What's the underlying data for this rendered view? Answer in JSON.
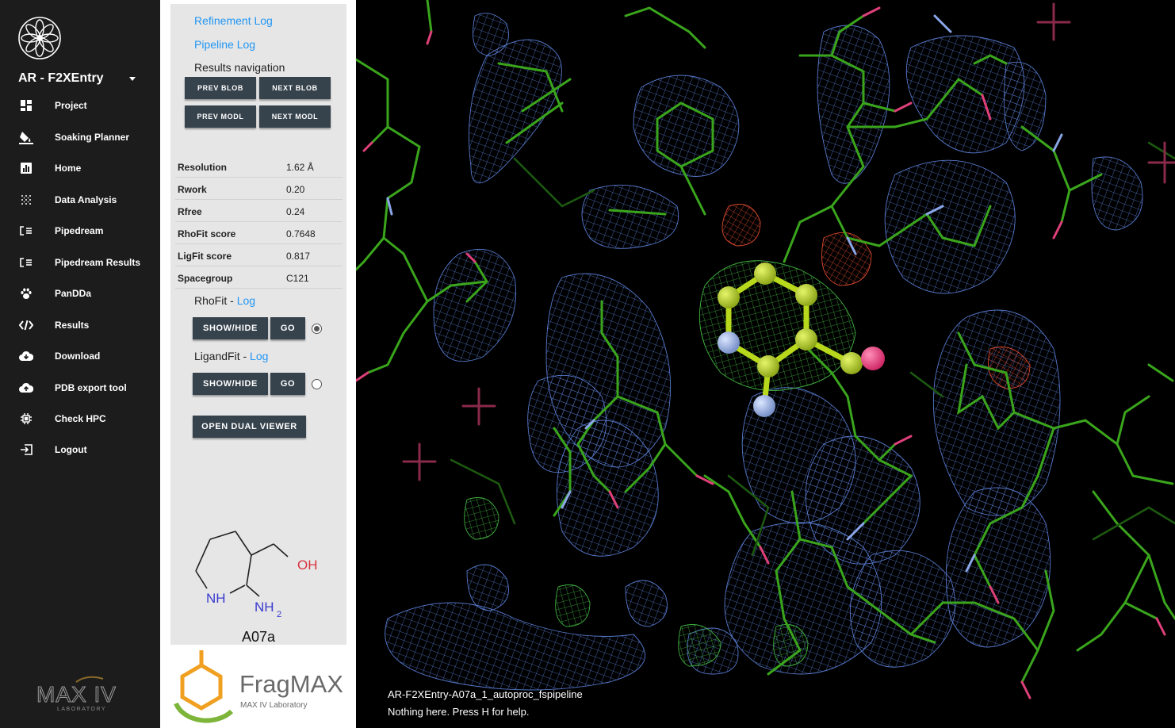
{
  "nav": {
    "project": "AR - F2XEntry",
    "items": [
      {
        "label": "Project",
        "icon": "dashboard-icon"
      },
      {
        "label": "Soaking Planner",
        "icon": "paint-bucket-icon"
      },
      {
        "label": "Home",
        "icon": "bar-chart-icon"
      },
      {
        "label": "Data Analysis",
        "icon": "grid-dots-icon"
      },
      {
        "label": "Pipedream",
        "icon": "list-check-icon"
      },
      {
        "label": "Pipedream Results",
        "icon": "list-check-icon"
      },
      {
        "label": "PanDDa",
        "icon": "paw-icon"
      },
      {
        "label": "Results",
        "icon": "code-slash-icon"
      },
      {
        "label": "Download",
        "icon": "cloud-download-icon"
      },
      {
        "label": "PDB export tool",
        "icon": "cloud-upload-icon"
      },
      {
        "label": "Check HPC",
        "icon": "chip-icon"
      },
      {
        "label": "Logout",
        "icon": "logout-icon"
      }
    ],
    "footer_logo_text": "MAX IV",
    "footer_logo_sub": "LABORATORY"
  },
  "panel": {
    "refinement_log": "Refinement Log",
    "pipeline_log": "Pipeline Log",
    "results_navigation": "Results navigation",
    "buttons": {
      "prev_blob": "PREV BLOB",
      "next_blob": "NEXT BLOB",
      "prev_modl": "PREV MODL",
      "next_modl": "NEXT MODL"
    },
    "stats": [
      {
        "key": "Resolution",
        "value": "1.62 Å"
      },
      {
        "key": "Rwork",
        "value": "0.20"
      },
      {
        "key": "Rfree",
        "value": "0.24"
      },
      {
        "key": "RhoFit score",
        "value": "0.7648"
      },
      {
        "key": "LigFit score",
        "value": "0.817"
      },
      {
        "key": "Spacegroup",
        "value": "C121"
      }
    ],
    "rhofit": {
      "name": "RhoFit",
      "log": "Log",
      "show_hide": "SHOW/HIDE",
      "go": "GO",
      "selected": true
    },
    "ligandfit": {
      "name": "LigandFit",
      "log": "Log",
      "show_hide": "SHOW/HIDE",
      "go": "GO",
      "selected": false
    },
    "open_dual_viewer": "OPEN DUAL VIEWER",
    "molecule_labels": {
      "oh": "OH",
      "nh": "NH",
      "nh2": "NH",
      "nh2_sub": "2"
    },
    "compound_id": "A07a",
    "fragmax_title": "FragMAX",
    "fragmax_sub": "MAX IV Laboratory"
  },
  "viewer": {
    "structure_name": "AR-F2XEntry-A07a_1_autoproc_fspipeline",
    "help_text": "Nothing here. Press H for help.",
    "colors": {
      "background": "#000000",
      "mesh_2fofc": "#5b7fd6",
      "mesh_diff_pos": "#3fae3f",
      "mesh_diff_neg": "#d8482e",
      "carbon": "#3aa51c",
      "oxygen": "#e0407a",
      "nitrogen": "#8aa6e8",
      "ligand_carbon": "#b8d81c"
    }
  }
}
